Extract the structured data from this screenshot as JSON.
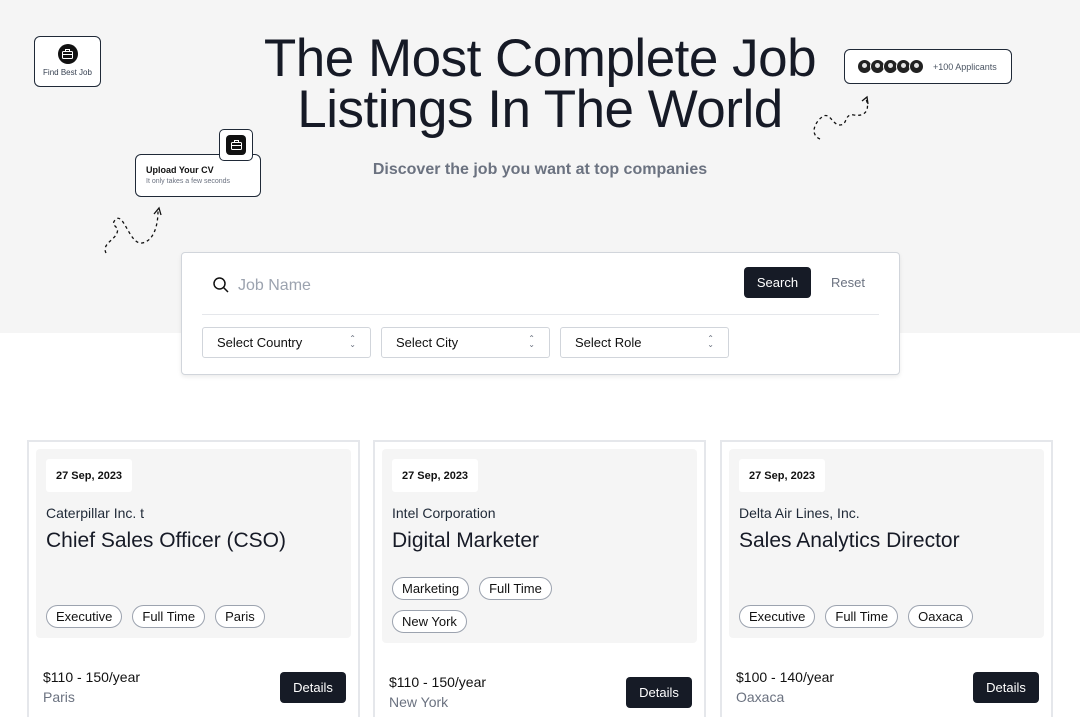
{
  "hero": {
    "title_line1": "The Most Complete Job",
    "title_line2": "Listings In The World",
    "subtitle": "Discover the job you want at top companies",
    "find_badge_label": "Find Best Job",
    "upload_card": {
      "title": "Upload Your CV",
      "subtitle": "It only takes a few seconds"
    },
    "applicants_label": "+100 Applicants"
  },
  "search": {
    "placeholder": "Job Name",
    "search_label": "Search",
    "reset_label": "Reset",
    "country_select": "Select Country",
    "city_select": "Select City",
    "role_select": "Select Role"
  },
  "jobs": [
    {
      "date": "27 Sep, 2023",
      "company": "Caterpillar Inc. t",
      "title": "Chief Sales Officer (CSO)",
      "tags": [
        "Executive",
        "Full Time",
        "Paris"
      ],
      "salary": "$110 - 150/year",
      "location": "Paris",
      "details_label": "Details"
    },
    {
      "date": "27 Sep, 2023",
      "company": "Intel Corporation",
      "title": "Digital Marketer",
      "tags": [
        "Marketing",
        "Full Time",
        "New York"
      ],
      "salary": "$110 - 150/year",
      "location": "New York",
      "details_label": "Details"
    },
    {
      "date": "27 Sep, 2023",
      "company": "Delta Air Lines, Inc.",
      "title": "Sales Analytics Director",
      "tags": [
        "Executive",
        "Full Time",
        "Oaxaca"
      ],
      "salary": "$100 - 140/year",
      "location": "Oaxaca",
      "details_label": "Details"
    }
  ],
  "colors": {
    "hero_bg": "#f5f5f5",
    "primary": "#161b26",
    "muted": "#6b7280"
  }
}
